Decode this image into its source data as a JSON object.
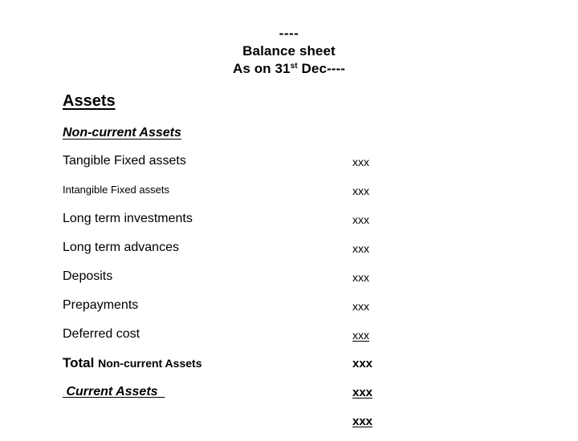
{
  "document": {
    "type": "balance-sheet-slide",
    "background_color": "#ffffff",
    "text_color": "#000000"
  },
  "header": {
    "line1": "----",
    "line2": "Balance sheet",
    "line3_prefix": "As on 31",
    "line3_ordinal": "st",
    "line3_suffix": " Dec----"
  },
  "sections": {
    "assets_heading": "Assets",
    "noncurrent_heading": "Non-current Assets"
  },
  "rows": [
    {
      "label": "Tangible Fixed assets",
      "amount": "xxx"
    },
    {
      "label": "Intangible Fixed assets",
      "amount": "xxx"
    },
    {
      "label": "Long term investments",
      "amount": "xxx"
    },
    {
      "label": "Long term advances",
      "amount": "xxx"
    },
    {
      "label": "Deposits",
      "amount": "xxx"
    },
    {
      "label": "Prepayments",
      "amount": "xxx"
    },
    {
      "label": "Deferred cost",
      "amount": "xxx"
    },
    {
      "label_lead": "Total ",
      "label_trail": "Non-current Assets",
      "amount": "xxx"
    },
    {
      "label": " Current Assets  ",
      "amount": "xxx"
    },
    {
      "label": "",
      "amount": "xxx"
    }
  ]
}
